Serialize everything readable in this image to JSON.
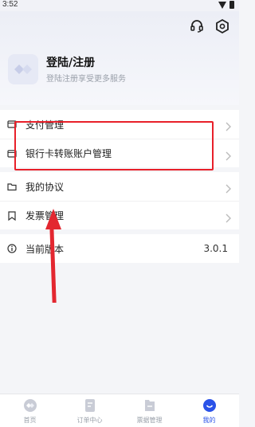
{
  "status_bar": {
    "time": "3:52"
  },
  "header": {
    "login_title": "登陆/注册",
    "login_subtitle": "登陆注册享受更多服务"
  },
  "menu_group_1": [
    {
      "label": "支付管理",
      "icon": "wallet-icon"
    },
    {
      "label": "银行卡转账账户管理",
      "icon": "wallet-icon"
    }
  ],
  "menu_group_2": [
    {
      "label": "我的协议",
      "icon": "folder-icon"
    },
    {
      "label": "发票管理",
      "icon": "bookmark-icon"
    }
  ],
  "menu_group_3": [
    {
      "label": "当前版本",
      "icon": "info-icon",
      "value": "3.0.1"
    }
  ],
  "tabbar": [
    {
      "label": "首页",
      "icon": "home-icon",
      "active": false
    },
    {
      "label": "订单中心",
      "icon": "order-icon",
      "active": false
    },
    {
      "label": "票据管理",
      "icon": "invoice-icon",
      "active": false
    },
    {
      "label": "我的",
      "icon": "profile-icon",
      "active": true
    }
  ],
  "colors": {
    "accent": "#2a52e8",
    "highlight": "#e8202a"
  }
}
